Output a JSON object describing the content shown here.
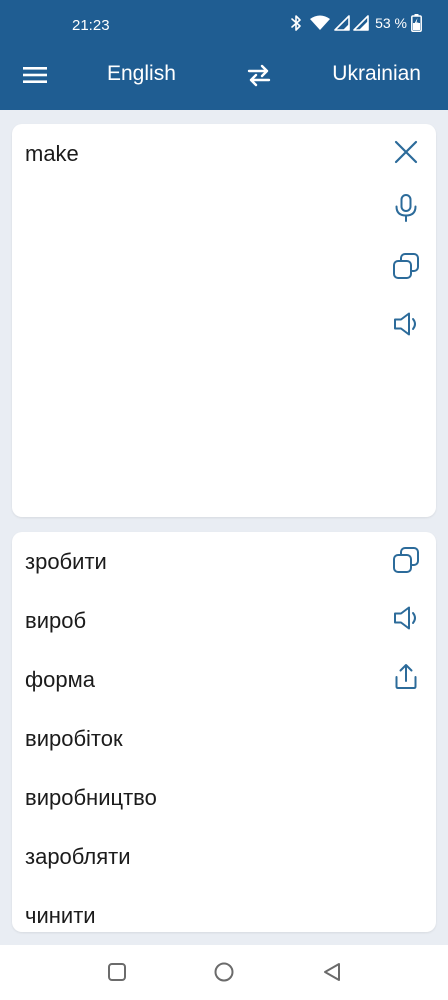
{
  "status_bar": {
    "time": "21:23",
    "battery_percent": "53 %",
    "icons": [
      "bluetooth-icon",
      "wifi-icon",
      "signal-icon",
      "signal-icon",
      "battery-charging-icon"
    ]
  },
  "app_bar": {
    "menu_icon": "hamburger-menu-icon",
    "source_language": "English",
    "swap_icon": "swap-arrows-icon",
    "target_language": "Ukrainian",
    "background_color": "#1f5d92"
  },
  "input": {
    "text": "make",
    "actions": [
      "close-icon",
      "microphone-icon",
      "copy-icon",
      "speaker-icon"
    ]
  },
  "results": {
    "items": [
      "зробити",
      "вироб",
      "форма",
      "виробіток",
      "виробництво",
      "заробляти",
      "чинити"
    ],
    "actions": [
      "copy-icon",
      "speaker-icon",
      "share-icon"
    ]
  },
  "nav_bar": {
    "buttons": [
      "recent-apps-icon",
      "home-icon",
      "back-icon"
    ]
  },
  "colors": {
    "accent": "#1f5d92",
    "icon": "#2c6b9a",
    "background": "#e9edf3",
    "card": "#ffffff"
  }
}
